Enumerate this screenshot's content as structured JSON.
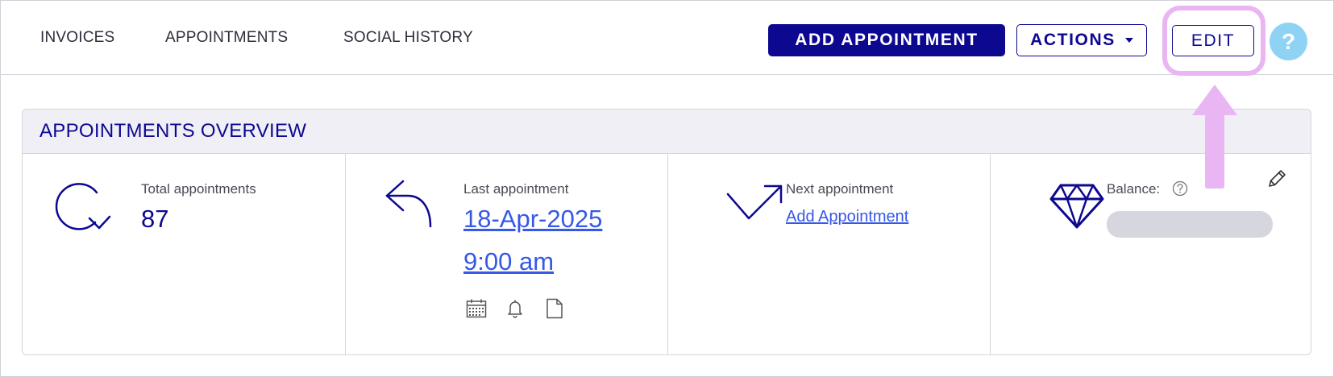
{
  "nav": {
    "tabs": [
      {
        "label": "INVOICES"
      },
      {
        "label": "APPOINTMENTS"
      },
      {
        "label": "SOCIAL HISTORY"
      }
    ],
    "add_appointment_label": "ADD APPOINTMENT",
    "actions_label": "ACTIONS",
    "edit_label": "EDIT",
    "help_label": "?"
  },
  "overview": {
    "title": "APPOINTMENTS OVERVIEW",
    "total": {
      "label": "Total appointments",
      "value": "87",
      "icon": "refresh-arrow-icon"
    },
    "last": {
      "label": "Last appointment",
      "date": "18-Apr-2025",
      "time": "9:00 am",
      "icon": "reply-arrow-icon",
      "actions": [
        "calendar-icon",
        "bell-icon",
        "document-icon"
      ]
    },
    "next": {
      "label": "Next appointment",
      "link": "Add Appointment",
      "icon": "trend-arrow-icon"
    },
    "balance": {
      "label": "Balance:",
      "icon": "diamond-icon"
    }
  },
  "colors": {
    "brand": "#0d0890",
    "link": "#3658e6",
    "help": "#8fd3f4",
    "highlight": "#e9b5f3"
  }
}
